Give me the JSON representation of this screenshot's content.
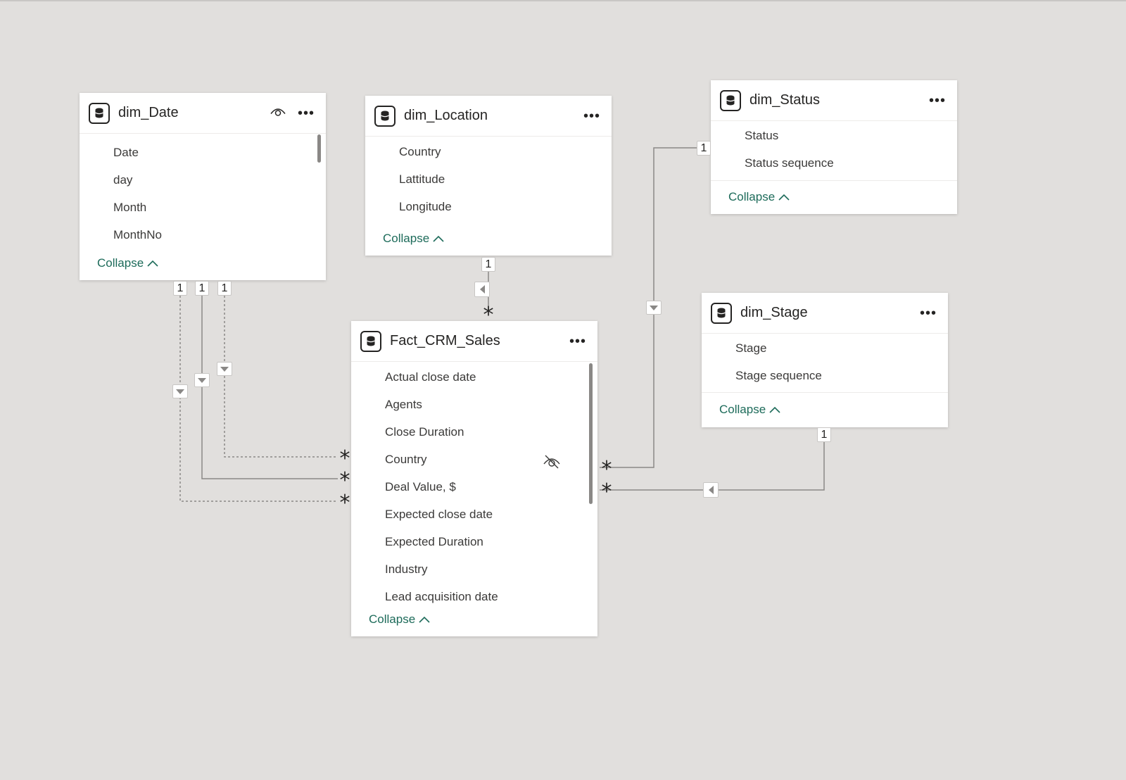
{
  "tables": {
    "dim_date": {
      "title": "dim_Date",
      "fields": [
        "Date",
        "day",
        "Month",
        "MonthNo"
      ],
      "collapse_label": "Collapse"
    },
    "dim_location": {
      "title": "dim_Location",
      "fields": [
        "Country",
        "Lattitude",
        "Longitude"
      ],
      "collapse_label": "Collapse"
    },
    "dim_status": {
      "title": "dim_Status",
      "fields": [
        "Status",
        "Status sequence"
      ],
      "collapse_label": "Collapse"
    },
    "dim_stage": {
      "title": "dim_Stage",
      "fields": [
        "Stage",
        "Stage sequence"
      ],
      "collapse_label": "Collapse"
    },
    "fact_crm_sales": {
      "title": "Fact_CRM_Sales",
      "fields": [
        "Actual close date",
        "Agents",
        "Close Duration",
        "Country",
        "Deal Value, $",
        "Expected close date",
        "Expected Duration",
        "Industry",
        "Lead acquisition date"
      ],
      "collapse_label": "Collapse"
    }
  },
  "cardinality": {
    "one": "1",
    "many": "*"
  },
  "colors": {
    "canvas": "#e1dfdd",
    "card": "#ffffff",
    "accent": "#1d6b5a",
    "line": "#8a8886"
  }
}
